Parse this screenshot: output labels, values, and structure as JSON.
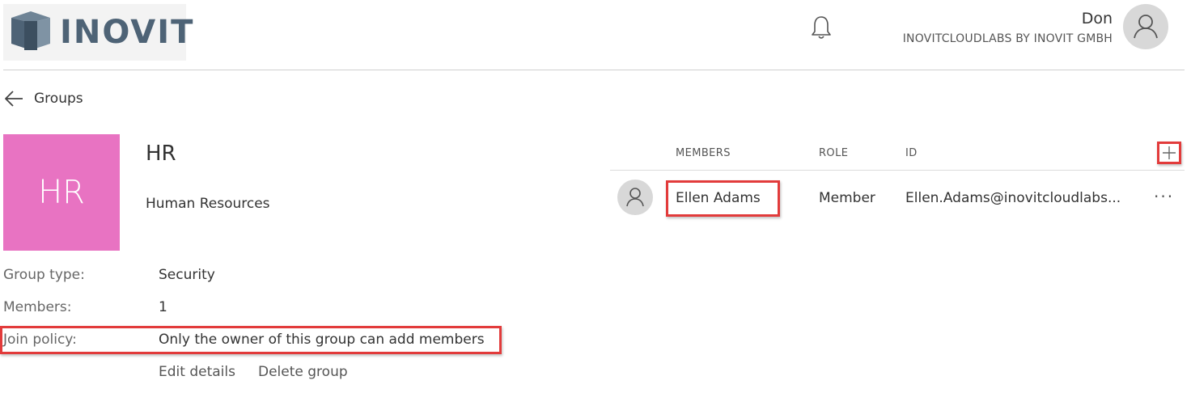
{
  "header": {
    "logo_text": "INOVIT",
    "user_name": "Don",
    "org_name": "INOVITCLOUDLABS BY INOVIT GMBH"
  },
  "nav": {
    "back_label": "Groups"
  },
  "group": {
    "initials": "HR",
    "name": "HR",
    "description": "Human Resources",
    "tile_color": "#e873c2",
    "properties": [
      {
        "label": "Group type:",
        "value": "Security"
      },
      {
        "label": "Members:",
        "value": "1"
      },
      {
        "label": "Join policy:",
        "value": "Only the owner of this group can add members"
      }
    ],
    "actions": {
      "edit": "Edit details",
      "delete": "Delete group"
    }
  },
  "members_table": {
    "columns": [
      "MEMBERS",
      "ROLE",
      "ID"
    ],
    "rows": [
      {
        "name": "Ellen Adams",
        "role": "Member",
        "id": "Ellen.Adams@inovitcloudlabs..."
      }
    ],
    "more_label": "···"
  },
  "colors": {
    "highlight": "#e23b3b",
    "logo": "#4e6376"
  }
}
